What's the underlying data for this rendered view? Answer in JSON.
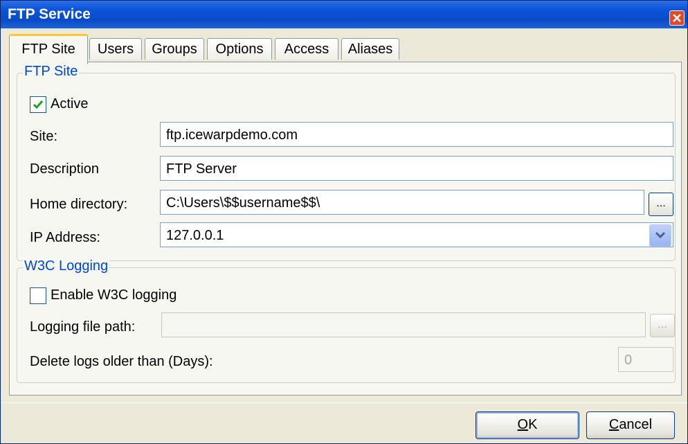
{
  "window": {
    "title": "FTP Service"
  },
  "tabs": [
    "FTP Site",
    "Users",
    "Groups",
    "Options",
    "Access",
    "Aliases"
  ],
  "ftp_site_group": {
    "legend": "FTP Site",
    "active": {
      "label": "Active",
      "checked": true
    },
    "site": {
      "label": "Site:",
      "value": "ftp.icewarpdemo.com"
    },
    "description": {
      "label": "Description",
      "value": "FTP Server"
    },
    "home_directory": {
      "label": "Home directory:",
      "value": "C:\\Users\\$$username$$\\",
      "browse": "..."
    },
    "ip_address": {
      "label": "IP Address:",
      "value": "127.0.0.1"
    }
  },
  "w3c_group": {
    "legend": "W3C Logging",
    "enable": {
      "label": "Enable W3C logging",
      "checked": false
    },
    "logging_path": {
      "label": "Logging file path:",
      "value": "",
      "browse": "..."
    },
    "delete_days": {
      "label": "Delete logs older than (Days):",
      "value": "0"
    }
  },
  "buttons": {
    "ok_accel": "O",
    "ok_rest": "K",
    "cancel_accel": "C",
    "cancel_rest": "ancel"
  },
  "colors": {
    "titlebar": "#0A4AC8",
    "legend": "#0046D5",
    "tab_highlight": "#FFC83C",
    "close": "#E0492B"
  }
}
